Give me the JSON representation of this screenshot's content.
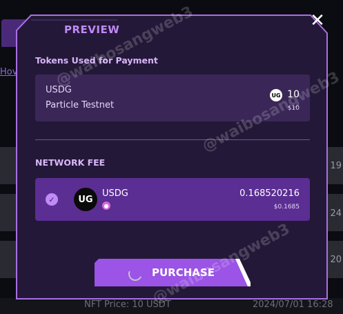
{
  "background": {
    "link_text": "Hov",
    "row_numbers": [
      "19",
      "24",
      "20"
    ],
    "footer_price": "NFT Price: 10 USDT",
    "footer_date": "2024/07/01 16:28"
  },
  "modal": {
    "title": "PREVIEW",
    "close_icon": "close-icon",
    "payment": {
      "section_label": "Tokens Used for Payment",
      "token_name": "USDG",
      "network": "Particle Testnet",
      "token_icon_text": "UG",
      "amount": "10",
      "usd": "$10"
    },
    "network_fee": {
      "section_label": "NETWORK FEE",
      "token_name": "USDG",
      "token_icon_text": "UG",
      "amount": "0.168520216",
      "usd": "$0.1685"
    },
    "purchase_label": "PURCHASE"
  },
  "watermark": "@waibosangweb3",
  "colors": {
    "accent": "#c08af7",
    "modal_bg": "#241838",
    "card_bg": "#3a2758",
    "selected_card_bg": "#5b2e93",
    "button": "#9b54e6"
  }
}
